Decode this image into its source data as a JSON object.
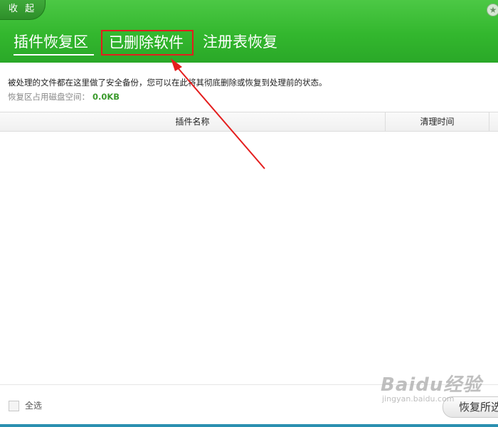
{
  "header": {
    "collapse_label": "收 起",
    "tabs": {
      "plugin_restore": "插件恢复区",
      "deleted_software": "已删除软件",
      "registry_restore": "注册表恢复"
    }
  },
  "info": {
    "description": "被处理的文件都在这里做了安全备份，您可以在此将其彻底删除或恢复到处理前的状态。",
    "disk_label": "恢复区占用磁盘空间：",
    "disk_value": "0.0KB"
  },
  "table": {
    "columns": [
      "插件名称",
      "清理时间"
    ],
    "rows": []
  },
  "footer": {
    "select_all_label": "全选",
    "restore_button_label": "恢复所选"
  },
  "watermark": {
    "logo": "Baidu经验",
    "url": "jingyan.baidu.com"
  },
  "colors": {
    "header_green": "#33b72e",
    "highlight_red": "#e41d1d",
    "disk_value_green": "#3a9a2c"
  }
}
